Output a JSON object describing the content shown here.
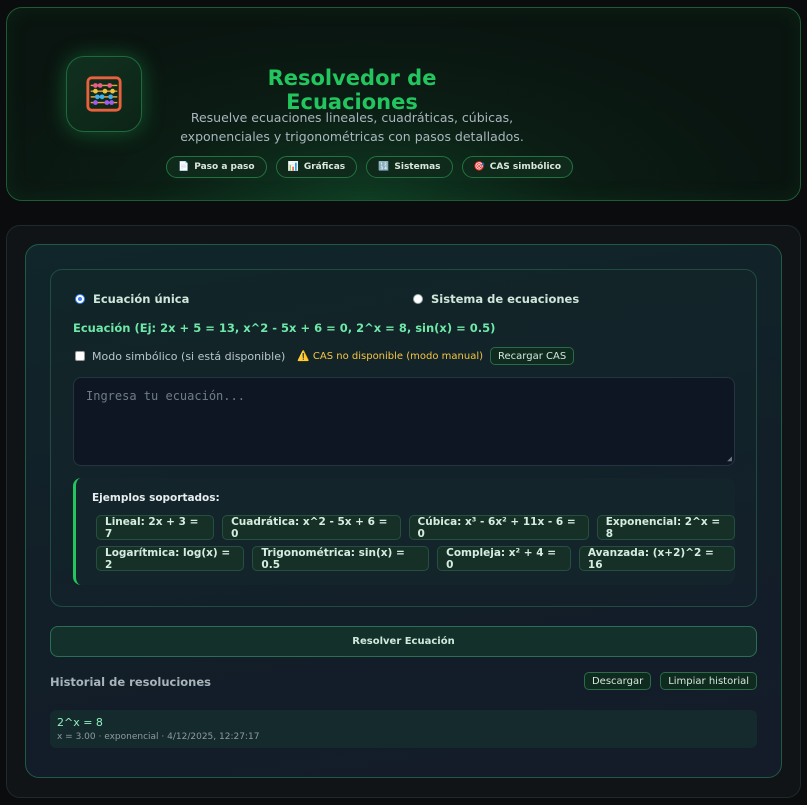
{
  "header": {
    "title": "Resolvedor de Ecuaciones",
    "subtitle_line1": "Resuelve ecuaciones lineales, cuadráticas, cúbicas,",
    "subtitle_line2": "exponenciales y trigonométricas con pasos detallados.",
    "logo_icon": "abacus-icon",
    "pills": [
      {
        "icon": "📄",
        "label": "Paso a paso"
      },
      {
        "icon": "📊",
        "label": "Gráficas"
      },
      {
        "icon": "🔢",
        "label": "Sistemas"
      },
      {
        "icon": "🎯",
        "label": "CAS simbólico"
      }
    ]
  },
  "form": {
    "mode_single": "Ecuación única",
    "mode_system": "Sistema de ecuaciones",
    "selected_mode": "single",
    "equation_label": "Ecuación (Ej: 2x + 5 = 13, x^2 - 5x + 6 = 0, 2^x = 8, sin(x) = 0.5)",
    "symbolic_mode_label": "Modo simbólico (si está disponible)",
    "symbolic_checked": false,
    "cas_warning": "⚠️ CAS no disponible (modo manual)",
    "reload_cas_label": "Recargar CAS",
    "input_value": "",
    "input_placeholder": "Ingresa tu ecuación...",
    "examples_title": "Ejemplos soportados:",
    "examples_row1": [
      "Lineal: 2x + 3 = 7",
      "Cuadrática: x^2 - 5x + 6 = 0",
      "Cúbica: x³ - 6x² + 11x - 6 = 0",
      "Exponencial: 2^x = 8"
    ],
    "examples_row2": [
      "Logarítmica: log(x) = 2",
      "Trigonométrica: sin(x) = 0.5",
      "Compleja: x² + 4 = 0",
      "Avanzada: (x+2)^2 = 16"
    ]
  },
  "solve_button": "Resolver Ecuación",
  "history": {
    "title": "Historial de resoluciones",
    "download_label": "Descargar",
    "clear_label": "Limpiar historial",
    "entries": [
      {
        "equation": "2^x = 8",
        "meta": "x = 3.00 · exponencial · 4/12/2025, 12:27:17"
      }
    ]
  },
  "colors": {
    "accent": "#22c55e",
    "warning": "#f5c542",
    "background": "#0a0c0d"
  }
}
